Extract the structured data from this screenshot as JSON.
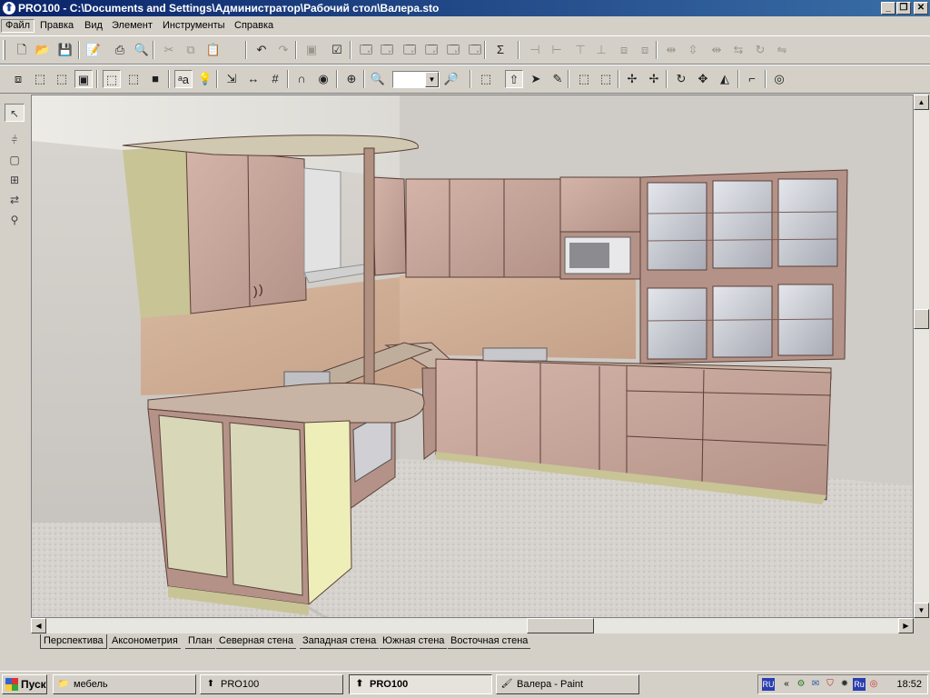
{
  "window": {
    "title": "PRO100 - C:\\Documents and Settings\\Администратор\\Рабочий стол\\Валера.sto",
    "icon": "pro100-app-icon",
    "min_label": "_",
    "max_label": "❐",
    "close_label": "✕"
  },
  "menu": {
    "items": [
      "Файл",
      "Правка",
      "Вид",
      "Элемент",
      "Инструменты",
      "Справка"
    ],
    "active": "Файл"
  },
  "toolbar1": {
    "buttons": [
      {
        "name": "new-file-icon",
        "glyph": "🗋"
      },
      {
        "name": "open-folder-icon",
        "glyph": "📂"
      },
      {
        "name": "save-disk-icon",
        "glyph": "💾"
      },
      {
        "name": "properties-edit-icon",
        "glyph": "📝"
      },
      {
        "name": "print-icon",
        "glyph": "⎙"
      },
      {
        "name": "print-preview-icon",
        "glyph": "🔍"
      },
      {
        "name": "cut-icon",
        "glyph": "✂",
        "disabled": true
      },
      {
        "name": "copy-icon",
        "glyph": "⧉",
        "disabled": true
      },
      {
        "name": "paste-icon",
        "glyph": "📋",
        "disabled": true
      },
      {
        "name": "undo-icon",
        "glyph": "↶"
      },
      {
        "name": "redo-icon",
        "glyph": "↷",
        "disabled": true
      },
      {
        "name": "group-icon",
        "glyph": "▣",
        "disabled": true
      },
      {
        "name": "checklist-icon",
        "glyph": "☑"
      },
      {
        "name": "view-window-icon",
        "glyph": "🗔"
      },
      {
        "name": "view-zoom-icon",
        "glyph": "🗔"
      },
      {
        "name": "view-edit-icon",
        "glyph": "🗔"
      },
      {
        "name": "view-dimensions-icon",
        "glyph": "🗔"
      },
      {
        "name": "view-light-icon",
        "glyph": "🗔"
      },
      {
        "name": "view-color-icon",
        "glyph": "🗔"
      },
      {
        "name": "sum-icon",
        "glyph": "Σ"
      },
      {
        "name": "align-left-icon",
        "glyph": "⊣",
        "disabled": true
      },
      {
        "name": "align-right-icon",
        "glyph": "⊢",
        "disabled": true
      },
      {
        "name": "align-top-icon",
        "glyph": "⊤",
        "disabled": true
      },
      {
        "name": "align-bottom-icon",
        "glyph": "⊥",
        "disabled": true
      },
      {
        "name": "align-front-icon",
        "glyph": "⧈",
        "disabled": true
      },
      {
        "name": "align-back-icon",
        "glyph": "⧈",
        "disabled": true
      },
      {
        "name": "distribute-h-icon",
        "glyph": "⇹",
        "disabled": true
      },
      {
        "name": "distribute-v-icon",
        "glyph": "⇳",
        "disabled": true
      },
      {
        "name": "distribute-d-icon",
        "glyph": "⇹",
        "disabled": true
      },
      {
        "name": "space-h-icon",
        "glyph": "⇆",
        "disabled": true
      },
      {
        "name": "rotate-tool-icon",
        "glyph": "↻",
        "disabled": true
      },
      {
        "name": "mirror-tool-icon",
        "glyph": "⇋",
        "disabled": true
      }
    ]
  },
  "toolbar2": {
    "buttons": [
      {
        "name": "view-box-icon",
        "glyph": "⧈"
      },
      {
        "name": "view-wire-icon",
        "glyph": "⬚"
      },
      {
        "name": "view-shaded-icon",
        "glyph": "⬚"
      },
      {
        "name": "view-textured-icon",
        "glyph": "▣",
        "pressed": true
      },
      {
        "name": "mode-cube1-icon",
        "glyph": "⬚",
        "pressed": true
      },
      {
        "name": "mode-cube2-icon",
        "glyph": "⬚"
      },
      {
        "name": "mode-cube3-icon",
        "glyph": "■"
      },
      {
        "name": "text-labels-icon",
        "glyph": "ᵃa",
        "pressed": true
      },
      {
        "name": "light-bulb-icon",
        "glyph": "💡"
      },
      {
        "name": "snap-icon",
        "glyph": "⇲"
      },
      {
        "name": "measure-icon",
        "glyph": "↔"
      },
      {
        "name": "grid-icon",
        "glyph": "#"
      },
      {
        "name": "magnet-icon",
        "glyph": "∩"
      },
      {
        "name": "target-color-icon",
        "glyph": "◉"
      },
      {
        "name": "target-center-icon",
        "glyph": "⊕"
      },
      {
        "name": "zoom-in-icon",
        "glyph": "🔍"
      },
      {
        "name": "zoom-out-icon",
        "glyph": "🔎"
      },
      {
        "name": "select-all-icon",
        "glyph": "⬚"
      },
      {
        "name": "move-up-icon",
        "glyph": "⇧",
        "pressed": true
      },
      {
        "name": "pointer-icon",
        "glyph": "➤"
      },
      {
        "name": "pencil-icon",
        "glyph": "✎"
      },
      {
        "name": "frame-icon",
        "glyph": "⬚"
      },
      {
        "name": "frame-edit-icon",
        "glyph": "⬚"
      },
      {
        "name": "pin-icon",
        "glyph": "✢"
      },
      {
        "name": "pin2-icon",
        "glyph": "✢"
      },
      {
        "name": "rotate-icon",
        "glyph": "↻"
      },
      {
        "name": "move-icon",
        "glyph": "✥"
      },
      {
        "name": "mirror-icon",
        "glyph": "◭"
      },
      {
        "name": "corner-icon",
        "glyph": "⌐"
      },
      {
        "name": "target-icon",
        "glyph": "◎"
      }
    ],
    "zoom_value": ""
  },
  "left_tools": [
    {
      "name": "select-arrow-icon",
      "glyph": "↖",
      "pressed": true
    },
    {
      "name": "cut-element-icon",
      "glyph": "⫩"
    },
    {
      "name": "box-tool-icon",
      "glyph": "▢"
    },
    {
      "name": "position-tool-icon",
      "glyph": "⊞"
    },
    {
      "name": "align-tool-icon",
      "glyph": "⇄"
    },
    {
      "name": "magnify-tool-icon",
      "glyph": "⚲"
    }
  ],
  "tabs": {
    "items": [
      "Перспектива",
      "Аксонометрия",
      "План",
      "Северная стена",
      "Западная стена",
      "Южная стена",
      "Восточная стена"
    ],
    "active": "Перспектива"
  },
  "taskbar": {
    "start_label": "Пуск",
    "items": [
      {
        "label": "мебель",
        "icon": "folder-icon",
        "glyph": "📁"
      },
      {
        "label": "PRO100",
        "icon": "pro100-icon",
        "glyph": "⬆"
      },
      {
        "label": "PRO100",
        "icon": "pro100-icon",
        "glyph": "⬆",
        "active": true
      },
      {
        "label": "Валера - Paint",
        "icon": "paint-icon",
        "glyph": "🖌"
      }
    ],
    "lang": "RU",
    "tray_chevron": "«",
    "tray_lang2": "Ru",
    "clock": "18:52"
  },
  "colors": {
    "title_start": "#0a246a",
    "title_end": "#3a6ea5",
    "wood": "#c9a898",
    "counter": "#c8b4a4",
    "cabinet_base": "#b89a92",
    "floor": "#d8d4d0",
    "wall": "#c8c4c0"
  }
}
